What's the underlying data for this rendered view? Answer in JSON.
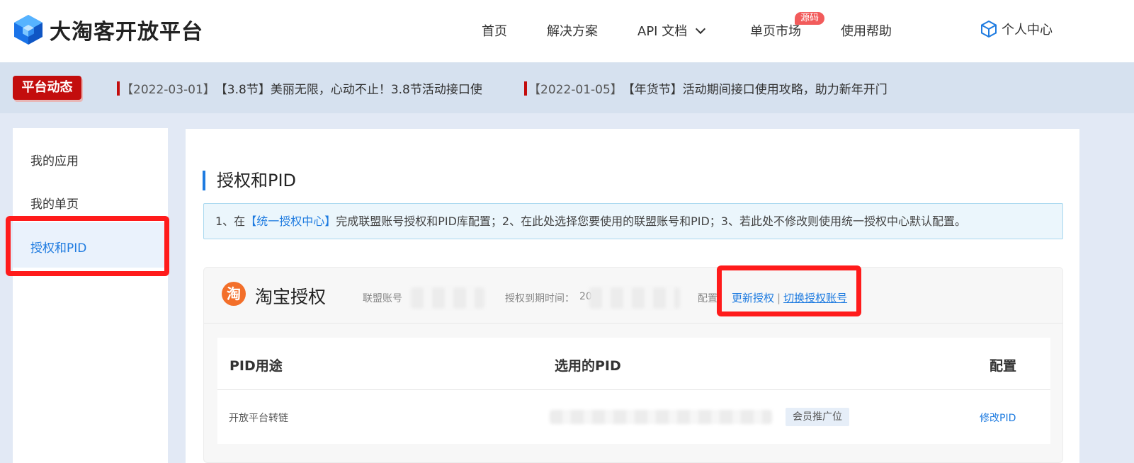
{
  "header": {
    "logo_text": "大淘客开放平台",
    "nav": {
      "home": "首页",
      "solutions": "解决方案",
      "api_docs": "API 文档",
      "single_page_market": "单页市场",
      "source_badge": "源码",
      "help": "使用帮助",
      "personal_center": "个人中心"
    }
  },
  "notice": {
    "badge": "平台动态",
    "items": [
      {
        "date": "【2022-03-01】",
        "text": "【3.8节】美丽无限，心动不止！3.8节活动接口使"
      },
      {
        "date": "【2022-01-05】",
        "text": "【年货节】活动期间接口使用攻略，助力新年开门"
      }
    ]
  },
  "sidebar": {
    "items": [
      {
        "label": "我的应用"
      },
      {
        "label": "我的单页"
      },
      {
        "label": "授权和PID"
      }
    ]
  },
  "main": {
    "title": "授权和PID",
    "info": {
      "prefix": "1、在",
      "link": "【统一授权中心】",
      "suffix": "完成联盟账号授权和PID库配置；2、在此处选择您要使用的联盟账号和PID；3、若此处不修改则使用统一授权中心默认配置。"
    },
    "taobao": {
      "logo_char": "淘",
      "title": "淘宝授权",
      "account_label": "联盟账号",
      "expiry_label": "授权到期时间：",
      "expiry_prefix": "20",
      "config_label": "配置",
      "update_auth": "更新授权",
      "separator": "|",
      "switch_account": "切换授权账号"
    },
    "table": {
      "headers": [
        "PID用途",
        "选用的PID",
        "配置"
      ],
      "rows": [
        {
          "usage": "开放平台转链",
          "tag": "会员推广位",
          "action": "修改PID"
        }
      ]
    }
  },
  "colors": {
    "accent": "#1e7be0",
    "notice_red": "#c30d0d",
    "highlight_red": "#ff1b1b",
    "taobao_orange": "#f36f2a"
  }
}
